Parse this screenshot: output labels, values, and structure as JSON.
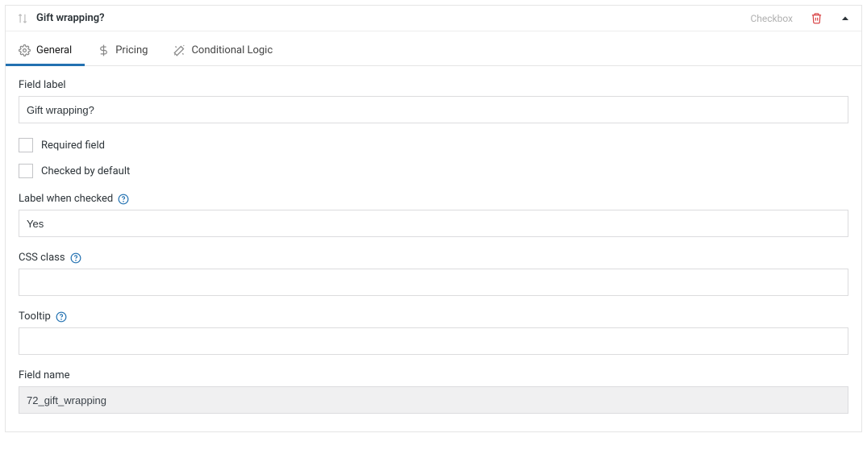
{
  "header": {
    "title": "Gift wrapping?",
    "type": "Checkbox"
  },
  "tabs": [
    {
      "label": "General",
      "icon": "gear"
    },
    {
      "label": "Pricing",
      "icon": "dollar"
    },
    {
      "label": "Conditional Logic",
      "icon": "wand"
    }
  ],
  "fields": {
    "field_label": {
      "label": "Field label",
      "value": "Gift wrapping?"
    },
    "required": {
      "label": "Required field",
      "checked": false
    },
    "checked_default": {
      "label": "Checked by default",
      "checked": false
    },
    "label_when_checked": {
      "label": "Label when checked",
      "value": "Yes"
    },
    "css_class": {
      "label": "CSS class",
      "value": ""
    },
    "tooltip": {
      "label": "Tooltip",
      "value": ""
    },
    "field_name": {
      "label": "Field name",
      "value": "72_gift_wrapping"
    }
  }
}
